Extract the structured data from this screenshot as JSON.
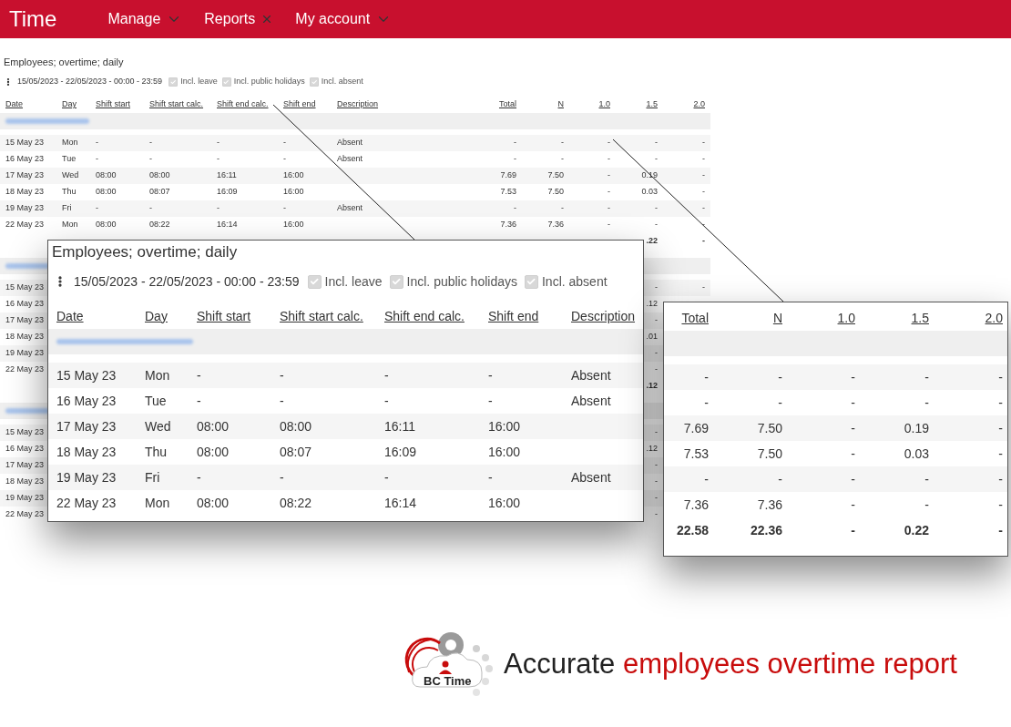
{
  "nav": {
    "brand": "Time",
    "items": [
      {
        "label": "Manage",
        "kind": "menu"
      },
      {
        "label": "Reports",
        "kind": "closable"
      },
      {
        "label": "My account",
        "kind": "menu"
      }
    ]
  },
  "report": {
    "title": "Employees; overtime; daily",
    "date_range": "15/05/2023 - 22/05/2023 - 00:00 - 23:59",
    "options": [
      {
        "label": "Incl. leave",
        "checked": true
      },
      {
        "label": "Incl. public holidays",
        "checked": true
      },
      {
        "label": "Incl. absent",
        "checked": true
      }
    ],
    "columns": [
      {
        "label": "Date",
        "kind": "text"
      },
      {
        "label": "Day",
        "kind": "text"
      },
      {
        "label": "Shift start",
        "kind": "text"
      },
      {
        "label": "Shift start calc.",
        "kind": "text"
      },
      {
        "label": "Shift end calc.",
        "kind": "text"
      },
      {
        "label": "Shift end",
        "kind": "text"
      },
      {
        "label": "Description",
        "kind": "text"
      },
      {
        "label": "Total",
        "kind": "number"
      },
      {
        "label": "N",
        "kind": "number"
      },
      {
        "label": "1.0",
        "kind": "number"
      },
      {
        "label": "1.5",
        "kind": "number"
      },
      {
        "label": "2.0",
        "kind": "number"
      }
    ],
    "groups": [
      {
        "rows": [
          {
            "date": "15 May 23",
            "day": "Mon",
            "shift_start": "-",
            "shift_start_calc": "-",
            "shift_end_calc": "-",
            "shift_end": "-",
            "description": "Absent",
            "total": "-",
            "n": "-",
            "r10": "-",
            "r15": "-",
            "r20": "-"
          },
          {
            "date": "16 May 23",
            "day": "Tue",
            "shift_start": "-",
            "shift_start_calc": "-",
            "shift_end_calc": "-",
            "shift_end": "-",
            "description": "Absent",
            "total": "-",
            "n": "-",
            "r10": "-",
            "r15": "-",
            "r20": "-"
          },
          {
            "date": "17 May 23",
            "day": "Wed",
            "shift_start": "08:00",
            "shift_start_calc": "08:00",
            "shift_end_calc": "16:11",
            "shift_end": "16:00",
            "total": "7.69",
            "n": "7.50",
            "r10": "-",
            "r15": "0.19",
            "r20": "-"
          },
          {
            "date": "18 May 23",
            "day": "Thu",
            "shift_start": "08:00",
            "shift_start_calc": "08:07",
            "shift_end_calc": "16:09",
            "shift_end": "16:00",
            "total": "7.53",
            "n": "7.50",
            "r10": "-",
            "r15": "0.03",
            "r20": "-"
          },
          {
            "date": "19 May 23",
            "day": "Fri",
            "shift_start": "-",
            "shift_start_calc": "-",
            "shift_end_calc": "-",
            "shift_end": "-",
            "description": "Absent",
            "total": "-",
            "n": "-",
            "r10": "-",
            "r15": "-",
            "r20": "-"
          },
          {
            "date": "22 May 23",
            "day": "Mon",
            "shift_start": "08:00",
            "shift_start_calc": "08:22",
            "shift_end_calc": "16:14",
            "shift_end": "16:00",
            "total": "7.36",
            "n": "7.36",
            "r10": "-",
            "r15": "-",
            "r20": "-"
          }
        ],
        "totals": {
          "r15": ".22",
          "r20": "-"
        }
      },
      {
        "rows": [
          {
            "date": "15 May 23",
            "r15": "-",
            "r20": "-"
          },
          {
            "date": "16 May 23",
            "r15": ".12"
          },
          {
            "date": "17 May 23",
            "r15": "-"
          },
          {
            "date": "18 May 23",
            "r15": ".01"
          },
          {
            "date": "19 May 23",
            "r15": "-"
          },
          {
            "date": "22 May 23",
            "r15": "-"
          }
        ],
        "totals": {
          "r15": ".12"
        }
      },
      {
        "rows": [
          {
            "date": "15 May 23",
            "r15": "-"
          },
          {
            "date": "16 May 23",
            "r15": ".12"
          },
          {
            "date": "17 May 23",
            "r15": "-"
          },
          {
            "date": "18 May 23",
            "r15": "-"
          },
          {
            "date": "19 May 23",
            "r15": "-"
          },
          {
            "date": "22 May 23",
            "r15": "-"
          }
        ]
      }
    ]
  },
  "callout_left": {
    "title": "Employees; overtime; daily",
    "date_range": "15/05/2023 - 22/05/2023 - 00:00 - 23:59",
    "options": [
      {
        "label": "Incl. leave",
        "checked": true
      },
      {
        "label": "Incl. public holidays",
        "checked": true
      },
      {
        "label": "Incl. absent",
        "checked": true
      }
    ],
    "columns": [
      "Date",
      "Day",
      "Shift start",
      "Shift start calc.",
      "Shift end calc.",
      "Shift end",
      "Description"
    ],
    "rows": [
      {
        "date": "15 May 23",
        "day": "Mon",
        "shift_start": "-",
        "shift_start_calc": "-",
        "shift_end_calc": "-",
        "shift_end": "-",
        "description": "Absent"
      },
      {
        "date": "16 May 23",
        "day": "Tue",
        "shift_start": "-",
        "shift_start_calc": "-",
        "shift_end_calc": "-",
        "shift_end": "-",
        "description": "Absent"
      },
      {
        "date": "17 May 23",
        "day": "Wed",
        "shift_start": "08:00",
        "shift_start_calc": "08:00",
        "shift_end_calc": "16:11",
        "shift_end": "16:00"
      },
      {
        "date": "18 May 23",
        "day": "Thu",
        "shift_start": "08:00",
        "shift_start_calc": "08:07",
        "shift_end_calc": "16:09",
        "shift_end": "16:00"
      },
      {
        "date": "19 May 23",
        "day": "Fri",
        "shift_start": "-",
        "shift_start_calc": "-",
        "shift_end_calc": "-",
        "shift_end": "-",
        "description": "Absent"
      },
      {
        "date": "22 May 23",
        "day": "Mon",
        "shift_start": "08:00",
        "shift_start_calc": "08:22",
        "shift_end_calc": "16:14",
        "shift_end": "16:00"
      }
    ]
  },
  "callout_right": {
    "columns": [
      "Total",
      "N",
      "1.0",
      "1.5",
      "2.0"
    ],
    "rows": [
      [
        "-",
        "-",
        "-",
        "-",
        "-"
      ],
      [
        "-",
        "-",
        "-",
        "-",
        "-"
      ],
      [
        "7.69",
        "7.50",
        "-",
        "0.19",
        "-"
      ],
      [
        "7.53",
        "7.50",
        "-",
        "0.03",
        "-"
      ],
      [
        "-",
        "-",
        "-",
        "-",
        "-"
      ],
      [
        "7.36",
        "7.36",
        "-",
        "-",
        "-"
      ]
    ],
    "totals": [
      "22.58",
      "22.36",
      "-",
      "0.22",
      "-"
    ]
  },
  "logo": {
    "text": "BC Time"
  },
  "tagline": {
    "lead": "Accurate",
    "highlight": "employees overtime report"
  }
}
